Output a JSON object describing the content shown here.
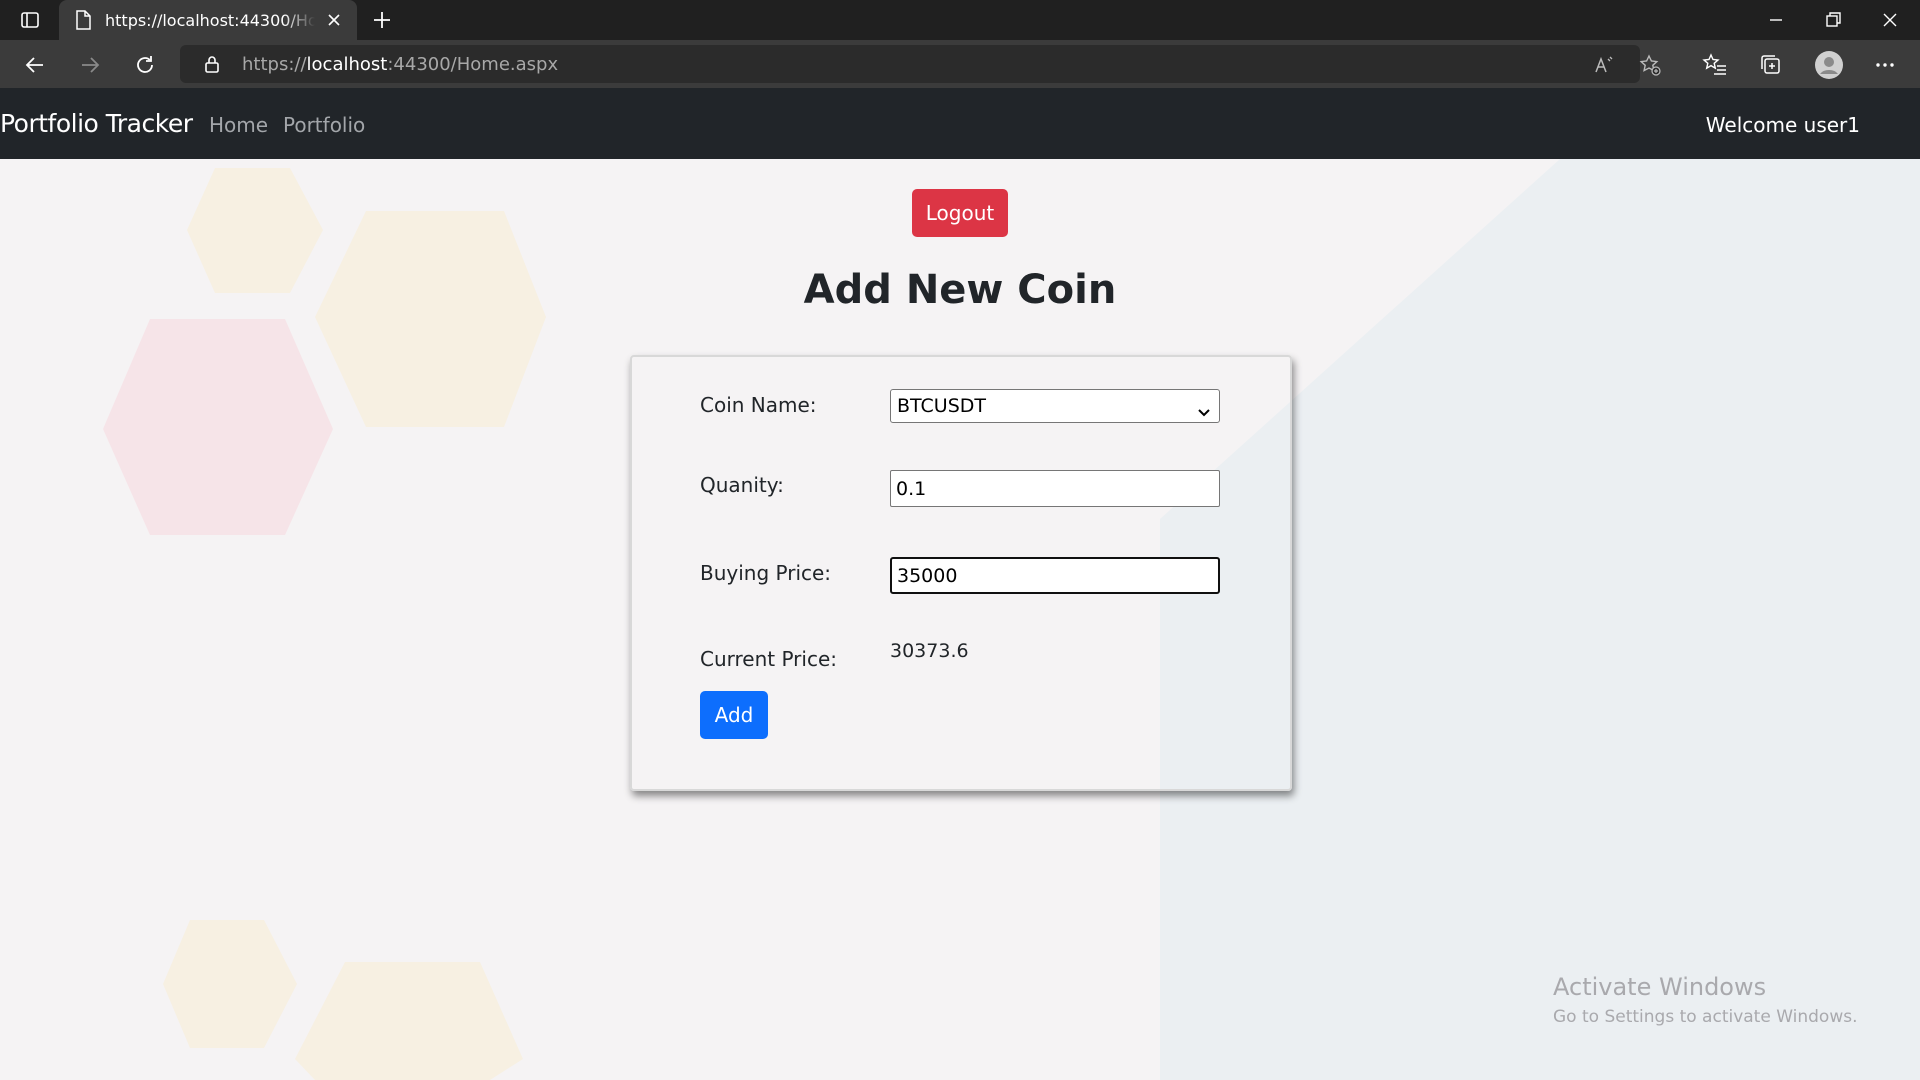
{
  "browser": {
    "tab_title": "https://localhost:44300/Home.aspx",
    "url_prefix": "https://",
    "url_host": "localhost",
    "url_path": ":44300/Home.aspx"
  },
  "navbar": {
    "brand": "Portfolio Tracker",
    "links": [
      "Home",
      "Portfolio"
    ],
    "welcome": "Welcome user1"
  },
  "page": {
    "logout_label": "Logout",
    "heading": "Add New Coin"
  },
  "form": {
    "coin_label": "Coin Name:",
    "coin_selected": "BTCUSDT",
    "quantity_label": "Quanity:",
    "quantity_value": "0.1",
    "buying_price_label": "Buying Price:",
    "buying_price_value": "35000",
    "current_price_label": "Current Price:",
    "current_price_value": "30373.6",
    "add_label": "Add"
  },
  "watermark": {
    "title": "Activate Windows",
    "subtitle": "Go to Settings to activate Windows."
  },
  "colors": {
    "danger": "#dc3545",
    "primary": "#0d6efd",
    "navbar": "#212529"
  }
}
